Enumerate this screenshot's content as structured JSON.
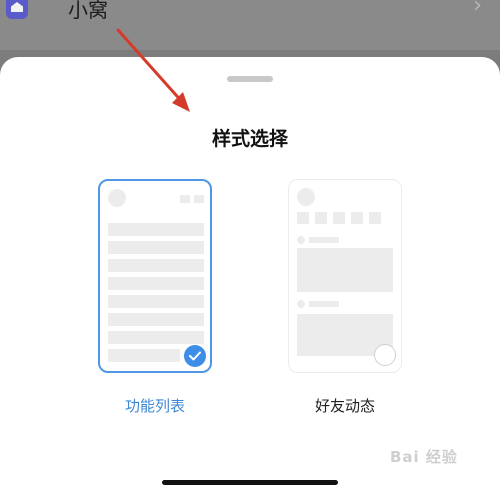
{
  "background": {
    "title": "小窝",
    "chevron": "›",
    "icon": "home-icon"
  },
  "sheet": {
    "title": "样式选择",
    "options": [
      {
        "label": "功能列表",
        "selected": true
      },
      {
        "label": "好友动态",
        "selected": false
      }
    ]
  },
  "watermark": {
    "text": "Bai 经验"
  },
  "colors": {
    "accent": "#3e8ee8",
    "arrow": "#d43b2a"
  }
}
